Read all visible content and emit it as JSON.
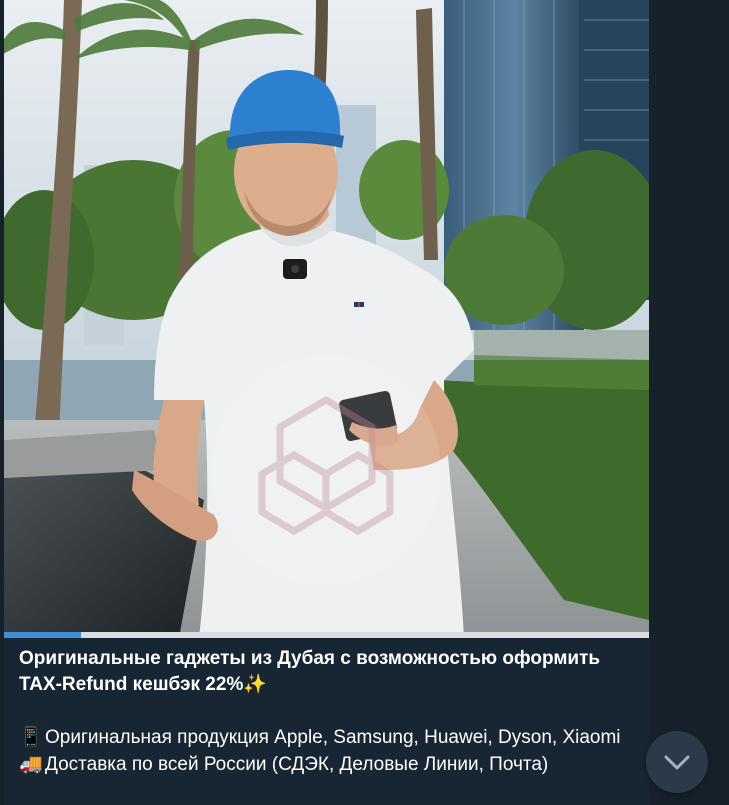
{
  "message": {
    "title": "Оригинальные гаджеты из Дубая с возможностью оформить TAX-Refund кешбэк 22%✨",
    "lines": [
      {
        "icon": "mobile-phone-icon",
        "emoji": "📱",
        "text": "Оригинальная продукция Apple, Samsung, Huawei, Dyson, Xiaomi"
      },
      {
        "icon": "delivery-truck-icon",
        "emoji": "🚚",
        "text": "Доставка по всей России (СДЭК, Деловые Линии, Почта)"
      }
    ]
  },
  "video": {
    "progress_fraction": 0.12,
    "watermark_icon": "hexagon-logo-icon"
  },
  "scroll_button": {
    "icon": "chevron-down-icon"
  },
  "colors": {
    "background": "#17212b",
    "card": "#182533",
    "progress_fill": "#3f8ed8",
    "progress_track": "#d9dde1",
    "cap": "#2d7fd0",
    "shirt": "#eef0f2"
  }
}
